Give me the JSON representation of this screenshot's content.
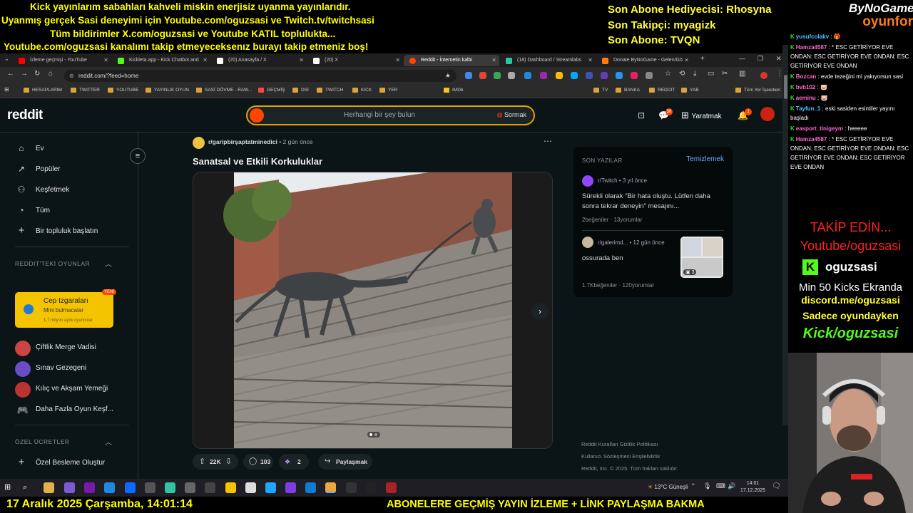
{
  "overlay": {
    "lines": [
      "Kick yayınlarım sabahları kahveli miskin enerjisiz uyanma yayınlarıdır.",
      "Uyanmış gerçek Sasi deneyimi için Youtube.com/oguzsasi ve Twitch.tv/twitchsasi",
      "Tüm bildirimler X.com/oguzsasi ve Youtube KATIL toplulukta...",
      "Youtube.com/oguzsasi kanalımı takip etmeyeceksenız burayı takip etmeniz boş!"
    ],
    "right": [
      "Son Abone Hediyecisi: Rhosyna",
      "Son Takipçi: myagizk",
      "Son Abone: TVQN"
    ],
    "brand_top": "ByNoGame",
    "brand_bottom": "oyunfor"
  },
  "browser": {
    "tabs": [
      {
        "label": "İzleme geçmişi - YouTube",
        "color": "#ff0000"
      },
      {
        "label": "Kickleta.app - Kick Chatbot and",
        "color": "#53fc18"
      },
      {
        "label": "(20) Anasayfa / X",
        "color": "#ffffff"
      },
      {
        "label": "(20) X",
        "color": "#ffffff"
      },
      {
        "label": "Reddit - İnternetin kalbi",
        "color": "#ff4500"
      },
      {
        "label": "(18) Dashboard / Streamlabs",
        "color": "#31c3a2"
      },
      {
        "label": "Donate ByNoGame - Gelen/Gö",
        "color": "#ff7a1a"
      }
    ],
    "url": "reddit.com/?feed=home",
    "bookmarks": [
      "HESAPLARIM",
      "TWITTER",
      "YOUTUBE",
      "YAYINLIK OYUN",
      "SASİ DÖVME - RAW...",
      "GEÇMİŞ",
      "DSİ",
      "TWITCH",
      "KICK",
      "YER",
      "IMDb",
      "TV",
      "BANKA",
      "REDDIT",
      "YAB",
      "Tüm Yer İşaretleri"
    ]
  },
  "reddit": {
    "logo": "reddit",
    "search_placeholder": "Herhangi bir şey bulun",
    "ask": "Sormak",
    "create": "Yaratmak",
    "chat_badge": "38",
    "notif_badge": "1",
    "nav": [
      "Ev",
      "Popüler",
      "Keşfetmek",
      "Tüm",
      "Bir topluluk başlatın"
    ],
    "games_header": "REDDIT'TEKİ OYUNLAR",
    "game_card": {
      "title": "Cep Izgaraları",
      "subtitle": "Mini bulmacalar",
      "users": "1,7 milyon aylık oyuncular",
      "badge": "YENİ"
    },
    "games": [
      "Çiftlik Merge Vadisi",
      "Sınav Gezegeni",
      "Kılıç ve Akşam Yemeği",
      "Daha Fazla Oyun Keşf..."
    ],
    "custom_header": "ÖZEL ÜCRETLER",
    "custom_item": "Özel Besleme Oluştur",
    "post": {
      "subreddit": "r/garipbirşaptatminedici",
      "time": "• 2 gün önce",
      "title": "Sanatsal ve Etkili Korkuluklar",
      "upvotes": "22K",
      "comments": "103",
      "awards": "2",
      "share": "Paylaşmak"
    },
    "recent": {
      "header": "SON YAZILAR",
      "clear": "Temizlemek",
      "items": [
        {
          "sub": "r/Twitch",
          "time": "• 3 yıl önce",
          "title": "Sürekli olarak \"Bir hata oluştu. Lütfen daha sonra tekrar deneyin\" mesajını...",
          "likes": "2beğeniler",
          "comments": "13yorumlar"
        },
        {
          "sub": "r/galerimd...",
          "time": "• 12 gün önce",
          "title": "ossurada ben",
          "likes": "1.7Kbeğeniler",
          "comments": "120yorumlar",
          "gallery_count": "3"
        }
      ]
    },
    "footer": [
      "Reddit Kuralları   Gizlilik Politikası",
      "Kullanıcı Sözleşmesi   Erişilebilirlik",
      "Reddit, Inc. © 2025. Tüm hakları saklıdır."
    ]
  },
  "chat": [
    {
      "user": "yusufcolakv",
      "color": "#4dc3ff",
      "text": ": 🎁"
    },
    {
      "user": "Hamza4587",
      "color": "#ff66cc",
      "text": ": * ESC GETİRİYOR EVE ONDAN: ESC GETİRİYOR EVE ONDAN: ESC GETİRİYOR EVE ONDAN"
    },
    {
      "user": "Bozcan",
      "color": "#ff66cc",
      "text": ": evde tezeğini mi yakıyorsun sasi"
    },
    {
      "user": "bvb102",
      "color": "#ff66cc",
      "text": ": 🐷"
    },
    {
      "user": "aeminu",
      "color": "#ff66cc",
      "text": ": 🐷"
    },
    {
      "user": "Tayfun_1",
      "color": "#4dc3ff",
      "text": ": eski sasiden esintiler yayını başladı"
    },
    {
      "user": "easport_tinigeym",
      "color": "#ff66cc",
      "text": ": heeeee"
    },
    {
      "user": "Hamza4587",
      "color": "#ff66cc",
      "text": ": * ESC GETİRİYOR EVE ONDAN: ESC GETİRİYOR EVE ONDAN: ESC GETİRİYOR EVE ONDAN: ESC GETİRİYOR EVE ONDAN"
    }
  ],
  "promo": {
    "l1": "TAKİP EDİN...",
    "l2": "Youtube/oguzsasi",
    "l3": "oguzsasi",
    "l4": "Min 50 Kicks Ekranda",
    "l5": "discord.me/oguzsasi",
    "l6": "Sadece oyundayken",
    "l7": "Kick/oguzsasi"
  },
  "taskbar": {
    "weather": "13°C  Güneşli",
    "time": "14:01",
    "date": "17.12.2025"
  },
  "ticker": {
    "datetime": "17 Aralık 2025 Çarşamba, 14:01:14",
    "message": "ABONELERE GEÇMİŞ YAYIN İZLEME + LİNK PAYLAŞMA BAKMA"
  }
}
